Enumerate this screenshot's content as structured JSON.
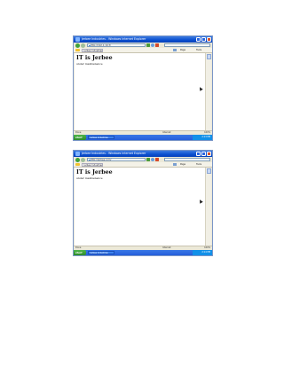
{
  "screenshots": [
    {
      "window_title": "Jerbee Industries - Windows Internet Explorer",
      "address": "http://192.1.10.3/",
      "tab_label": "Jerbee Industries",
      "page_menu": "Page",
      "tools_menu": "Tools",
      "heading": "IT is Jerbee",
      "subtext": "under maintenance",
      "status_text": "Done",
      "zone_text": "Internet",
      "zoom_text": "100%",
      "start_label": "start",
      "task_label": "Jerbee Industries",
      "clock": "2:13 PM"
    },
    {
      "window_title": "Jerbee Industries - Windows Internet Explorer",
      "address": "http://jerbee.com/",
      "tab_label": "Jerbee Industries",
      "page_menu": "Page",
      "tools_menu": "Tools",
      "heading": "IT is Jerbee",
      "subtext": "under maintenance",
      "status_text": "Done",
      "zone_text": "Internet",
      "zoom_text": "100%",
      "start_label": "start",
      "task_label": "Jerbee Industries",
      "clock": "2:14 PM"
    }
  ]
}
